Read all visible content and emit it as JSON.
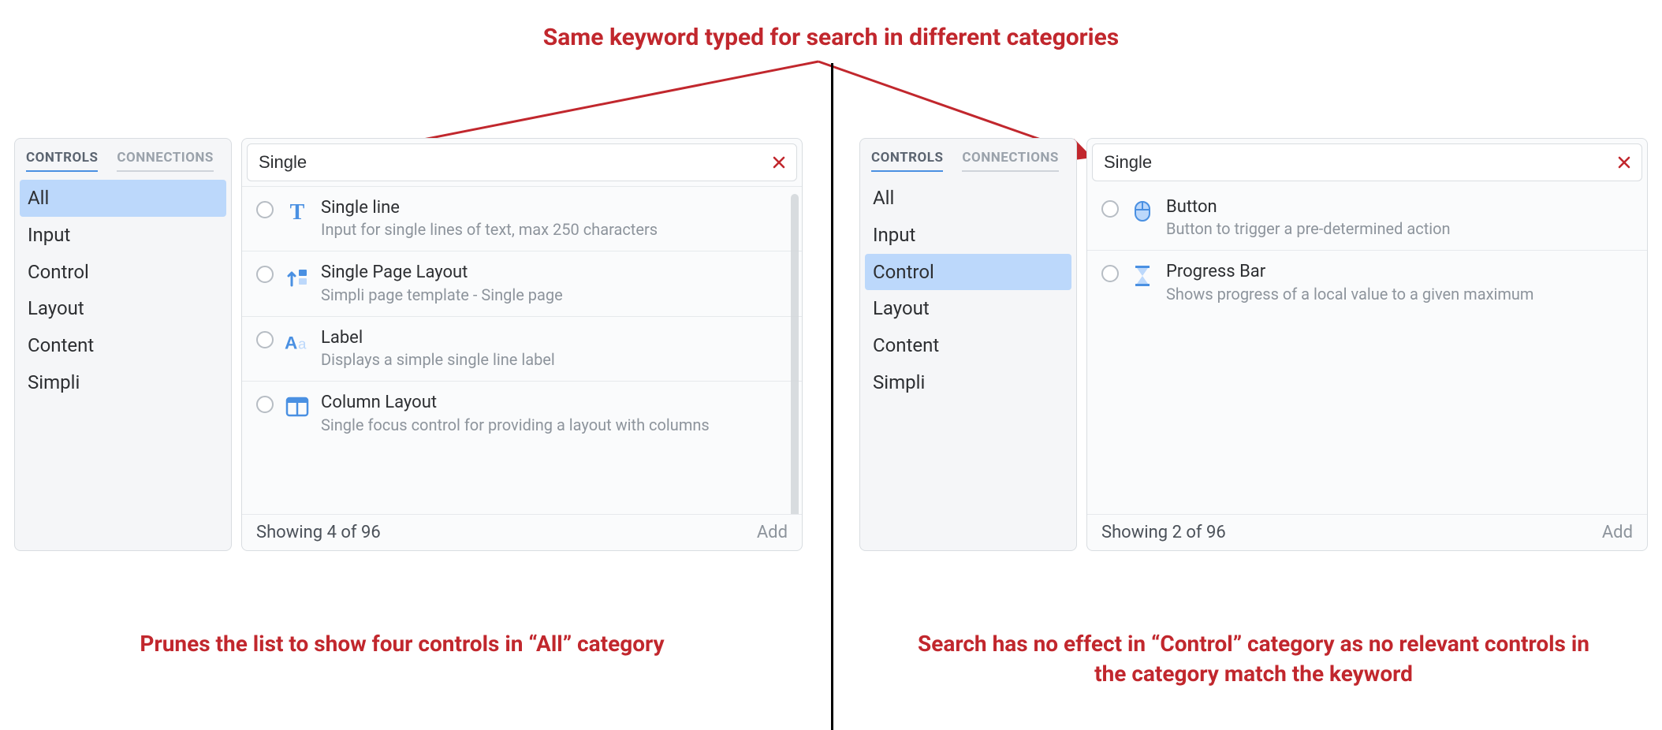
{
  "headline": "Same keyword typed for search in different categories",
  "captions": {
    "left": "Prunes the list to show four controls in “All” category",
    "right": "Search has no effect in “Control” category as no relevant controls in the category match the keyword"
  },
  "tabs": {
    "controls": "CONTROLS",
    "connections": "CONNECTIONS"
  },
  "categories": [
    "All",
    "Input",
    "Control",
    "Layout",
    "Content",
    "Simpli"
  ],
  "left": {
    "selected_category_index": 0,
    "search_value": "Single",
    "results": [
      {
        "icon": "text-icon",
        "title": "Single line",
        "desc": "Input for single lines of text, max 250 characters"
      },
      {
        "icon": "page-up-icon",
        "title": "Single Page Layout",
        "desc": "Simpli page template - Single page"
      },
      {
        "icon": "aa-icon",
        "title": "Label",
        "desc": "Displays a simple single line label"
      },
      {
        "icon": "columns-icon",
        "title": "Column Layout",
        "desc": "Single focus control for providing a layout with columns"
      }
    ],
    "footer": {
      "showing": "Showing 4 of 96",
      "add": "Add"
    }
  },
  "right": {
    "selected_category_index": 2,
    "search_value": "Single",
    "results": [
      {
        "icon": "mouse-icon",
        "title": "Button",
        "desc": "Button to trigger a pre-determined action"
      },
      {
        "icon": "hourglass-icon",
        "title": "Progress Bar",
        "desc": "Shows progress of a local value to a given maximum"
      }
    ],
    "footer": {
      "showing": "Showing 2 of 96",
      "add": "Add"
    }
  }
}
